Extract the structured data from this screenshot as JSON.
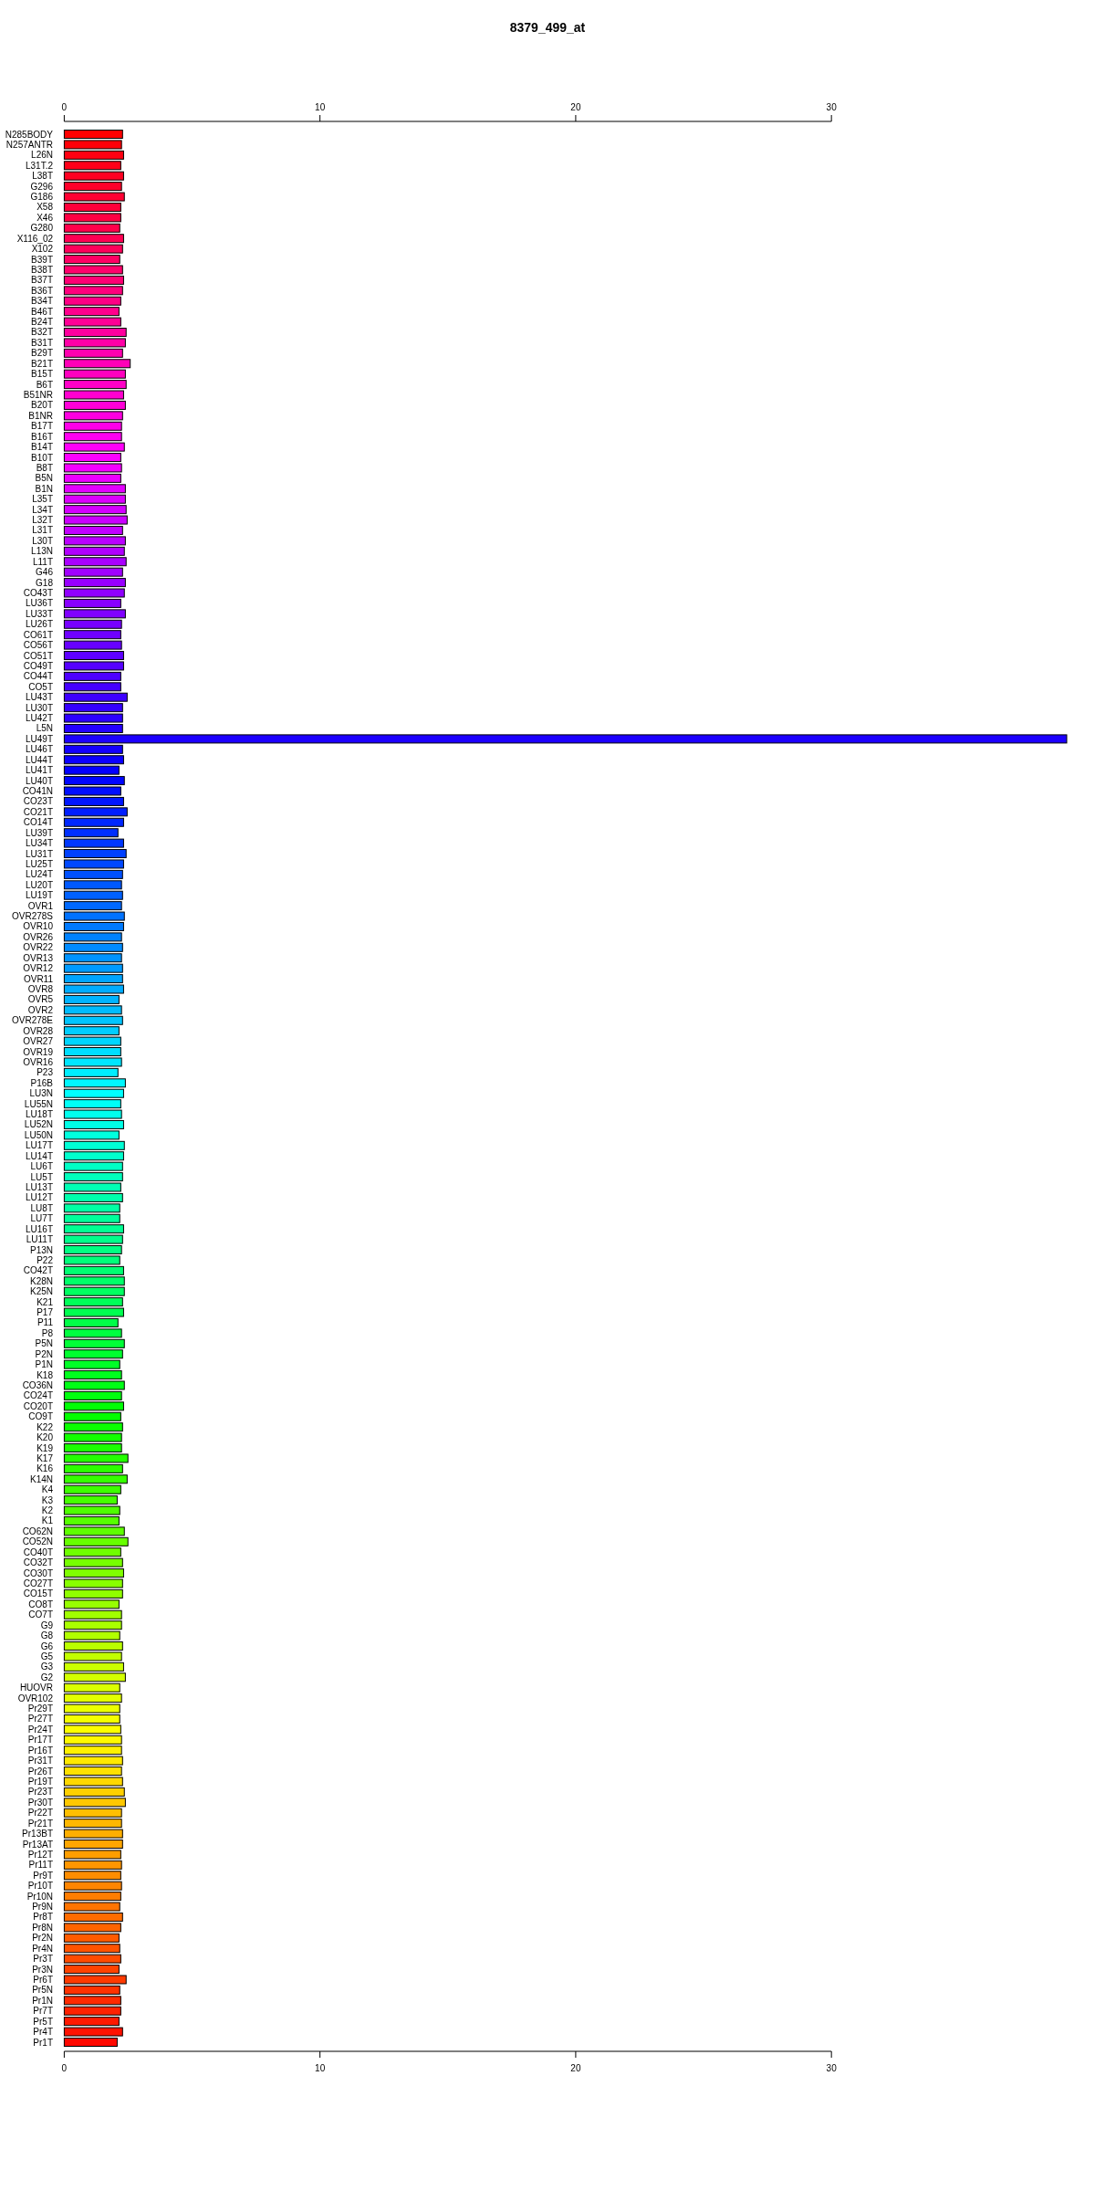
{
  "top_axis": {
    "ticks": [
      "0",
      "10",
      "20",
      "30"
    ]
  },
  "chart_data": {
    "type": "bar",
    "orientation": "horizontal",
    "title": "8379_499_at",
    "xlim": [
      0,
      39.2
    ],
    "xticks": [
      0,
      10,
      20,
      30
    ],
    "categories": [
      "N285BODY",
      "N257ANTR",
      "L26N",
      "L31T.2",
      "L38T",
      "G296",
      "G186",
      "X58",
      "X46",
      "G280",
      "X116_02",
      "X102",
      "B39T",
      "B38T",
      "B37T",
      "B36T",
      "B34T",
      "B46T",
      "B24T",
      "B32T",
      "B31T",
      "B29T",
      "B21T",
      "B15T",
      "B6T",
      "B51NR",
      "B20T",
      "B1NR",
      "B17T",
      "B16T",
      "B14T",
      "B10T",
      "B8T",
      "B5N",
      "B1N",
      "L35T",
      "L34T",
      "L32T",
      "L31T",
      "L30T",
      "L13N",
      "L11T",
      "G46",
      "G18",
      "CO43T",
      "LU36T",
      "LU33T",
      "LU26T",
      "CO61T",
      "CO56T",
      "CO51T",
      "CO49T",
      "CO44T",
      "CO5T",
      "LU43T",
      "LU30T",
      "LU42T",
      "L5N",
      "LU49T",
      "LU46T",
      "LU44T",
      "LU41T",
      "LU40T",
      "CO41N",
      "CO23T",
      "CO21T",
      "CO14T",
      "LU39T",
      "LU34T",
      "LU31T",
      "LU25T",
      "LU24T",
      "LU20T",
      "LU19T",
      "OVR1",
      "OVR278S",
      "OVR10",
      "OVR26",
      "OVR22",
      "OVR13",
      "OVR12",
      "OVR11",
      "OVR8",
      "OVR5",
      "OVR2",
      "OVR278E",
      "OVR28",
      "OVR27",
      "OVR19",
      "OVR16",
      "P23",
      "P16B",
      "LU3N",
      "LU55N",
      "LU18T",
      "LU52N",
      "LU50N",
      "LU17T",
      "LU14T",
      "LU6T",
      "LU5T",
      "LU13T",
      "LU12T",
      "LU8T",
      "LU7T",
      "LU16T",
      "LU11T",
      "P13N",
      "P22",
      "CO42T",
      "K28N",
      "K25N",
      "K21",
      "P17",
      "P11",
      "P8",
      "P5N",
      "P2N",
      "P1N",
      "K18",
      "CO36N",
      "CO24T",
      "CO20T",
      "CO9T",
      "K22",
      "K20",
      "K19",
      "K17",
      "K16",
      "K14N",
      "K4",
      "K3",
      "K2",
      "K1",
      "CO62N",
      "CO52N",
      "CO40T",
      "CO32T",
      "CO30T",
      "CO27T",
      "CO15T",
      "CO8T",
      "CO7T",
      "G9",
      "G8",
      "G6",
      "G5",
      "G3",
      "G2",
      "HUOVR",
      "OVR102",
      "Pr29T",
      "Pr27T",
      "Pr24T",
      "Pr17T",
      "Pr16T",
      "Pr31T",
      "Pr26T",
      "Pr19T",
      "Pr23T",
      "Pr30T",
      "Pr22T",
      "Pr21T",
      "Pr13BT",
      "Pr13AT",
      "Pr12T",
      "Pr11T",
      "Pr9T",
      "Pr10T",
      "Pr10N",
      "Pr9N",
      "Pr8T",
      "Pr8N",
      "Pr2N",
      "Pr4N",
      "Pr3T",
      "Pr3N",
      "Pr6T",
      "Pr5N",
      "Pr1N",
      "Pr7T",
      "Pr5T",
      "Pr4T",
      "Pr1T"
    ],
    "values": [
      2.28,
      2.24,
      2.32,
      2.21,
      2.32,
      2.24,
      2.35,
      2.21,
      2.21,
      2.17,
      2.32,
      2.28,
      2.17,
      2.28,
      2.32,
      2.28,
      2.21,
      2.14,
      2.21,
      2.42,
      2.39,
      2.28,
      2.58,
      2.39,
      2.42,
      2.32,
      2.39,
      2.28,
      2.24,
      2.24,
      2.35,
      2.21,
      2.24,
      2.21,
      2.39,
      2.39,
      2.42,
      2.46,
      2.28,
      2.39,
      2.35,
      2.42,
      2.28,
      2.39,
      2.35,
      2.21,
      2.39,
      2.24,
      2.21,
      2.24,
      2.32,
      2.32,
      2.21,
      2.21,
      2.46,
      2.28,
      2.28,
      2.28,
      39.2,
      2.28,
      2.32,
      2.14,
      2.35,
      2.21,
      2.32,
      2.46,
      2.32,
      2.1,
      2.32,
      2.42,
      2.32,
      2.28,
      2.24,
      2.28,
      2.24,
      2.35,
      2.32,
      2.24,
      2.28,
      2.24,
      2.28,
      2.28,
      2.32,
      2.14,
      2.24,
      2.28,
      2.14,
      2.21,
      2.21,
      2.24,
      2.1,
      2.39,
      2.32,
      2.21,
      2.24,
      2.32,
      2.14,
      2.35,
      2.32,
      2.28,
      2.28,
      2.21,
      2.28,
      2.17,
      2.17,
      2.32,
      2.28,
      2.24,
      2.17,
      2.32,
      2.35,
      2.35,
      2.28,
      2.32,
      2.1,
      2.24,
      2.35,
      2.28,
      2.17,
      2.24,
      2.35,
      2.24,
      2.32,
      2.21,
      2.28,
      2.24,
      2.24,
      2.49,
      2.28,
      2.46,
      2.21,
      2.07,
      2.17,
      2.14,
      2.35,
      2.49,
      2.21,
      2.28,
      2.32,
      2.28,
      2.28,
      2.14,
      2.24,
      2.24,
      2.17,
      2.28,
      2.24,
      2.32,
      2.39,
      2.17,
      2.24,
      2.17,
      2.17,
      2.21,
      2.24,
      2.24,
      2.28,
      2.24,
      2.28,
      2.35,
      2.39,
      2.24,
      2.24,
      2.28,
      2.28,
      2.21,
      2.24,
      2.21,
      2.24,
      2.21,
      2.17,
      2.28,
      2.21,
      2.14,
      2.17,
      2.21,
      2.14,
      2.42,
      2.17,
      2.21,
      2.21,
      2.14,
      2.28,
      2.07
    ]
  }
}
